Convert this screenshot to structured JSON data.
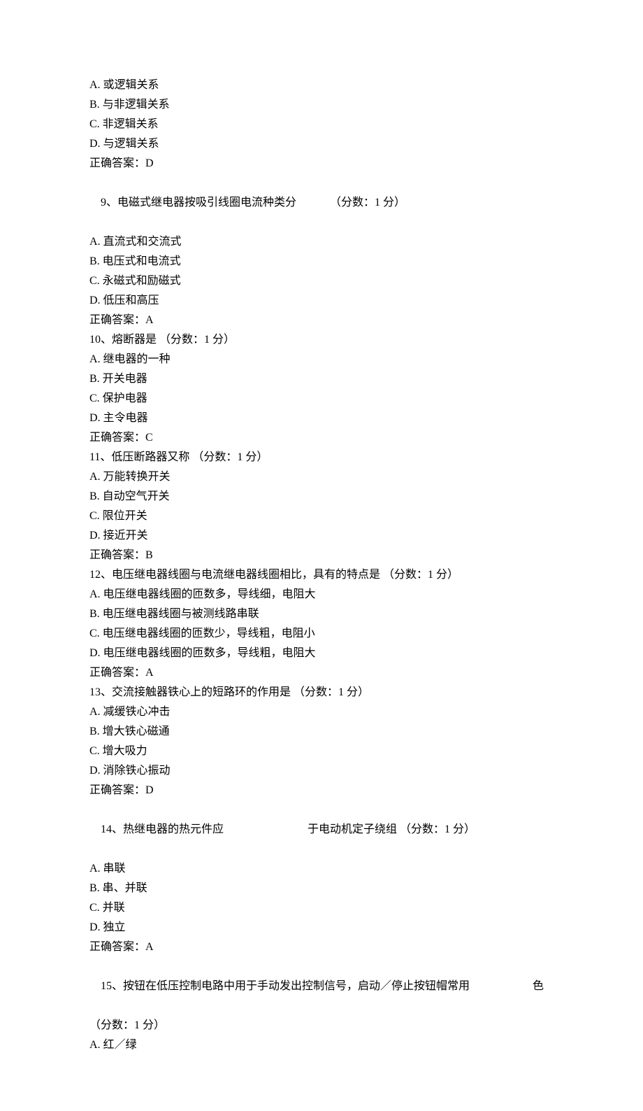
{
  "q8": {
    "optA": "A. 或逻辑关系",
    "optB": "B. 与非逻辑关系",
    "optC": "C. 非逻辑关系",
    "optD": "D. 与逻辑关系",
    "answer": "正确答案：D"
  },
  "q9": {
    "stem": "9、电磁式继电器按吸引线圈电流种类分",
    "score": "（分数：1 分）",
    "optA": "A. 直流式和交流式",
    "optB": "B. 电压式和电流式",
    "optC": "C. 永磁式和励磁式",
    "optD": "D. 低压和高压",
    "answer": "正确答案：A"
  },
  "q10": {
    "stem": "10、熔断器是 （分数：1 分）",
    "optA": "A. 继电器的一种",
    "optB": "B. 开关电器",
    "optC": "C. 保护电器",
    "optD": "D. 主令电器",
    "answer": "正确答案：C"
  },
  "q11": {
    "stem": "11、低压断路器又称 （分数：1 分）",
    "optA": "A. 万能转换开关",
    "optB": "B. 自动空气开关",
    "optC": "C. 限位开关",
    "optD": "D. 接近开关",
    "answer": "正确答案：B"
  },
  "q12": {
    "stem": "12、电压继电器线圈与电流继电器线圈相比，具有的特点是 （分数：1 分）",
    "optA": "A. 电压继电器线圈的匝数多，导线细，电阻大",
    "optB": "B. 电压继电器线圈与被测线路串联",
    "optC": "C. 电压继电器线圈的匝数少，导线粗，电阻小",
    "optD": "D. 电压继电器线圈的匝数多，导线粗，电阻大",
    "answer": "正确答案：A"
  },
  "q13": {
    "stem": "13、交流接触器铁心上的短路环的作用是 （分数：1 分）",
    "optA": "A. 减缓铁心冲击",
    "optB": "B. 增大铁心磁通",
    "optC": "C. 增大吸力",
    "optD": "D. 消除铁心振动",
    "answer": "正确答案：D"
  },
  "q14": {
    "stem": "14、热继电器的热元件应",
    "stem2": "于电动机定子绕组 （分数：1 分）",
    "optA": "A. 串联",
    "optB": "B. 串、并联",
    "optC": "C. 并联",
    "optD": "D. 独立",
    "answer": "正确答案：A"
  },
  "q15": {
    "stem": "15、按钮在低压控制电路中用于手动发出控制信号，启动／停止按钮帽常用",
    "stem2": "色",
    "score": "（分数：1 分）",
    "optA": "A. 红／绿"
  }
}
